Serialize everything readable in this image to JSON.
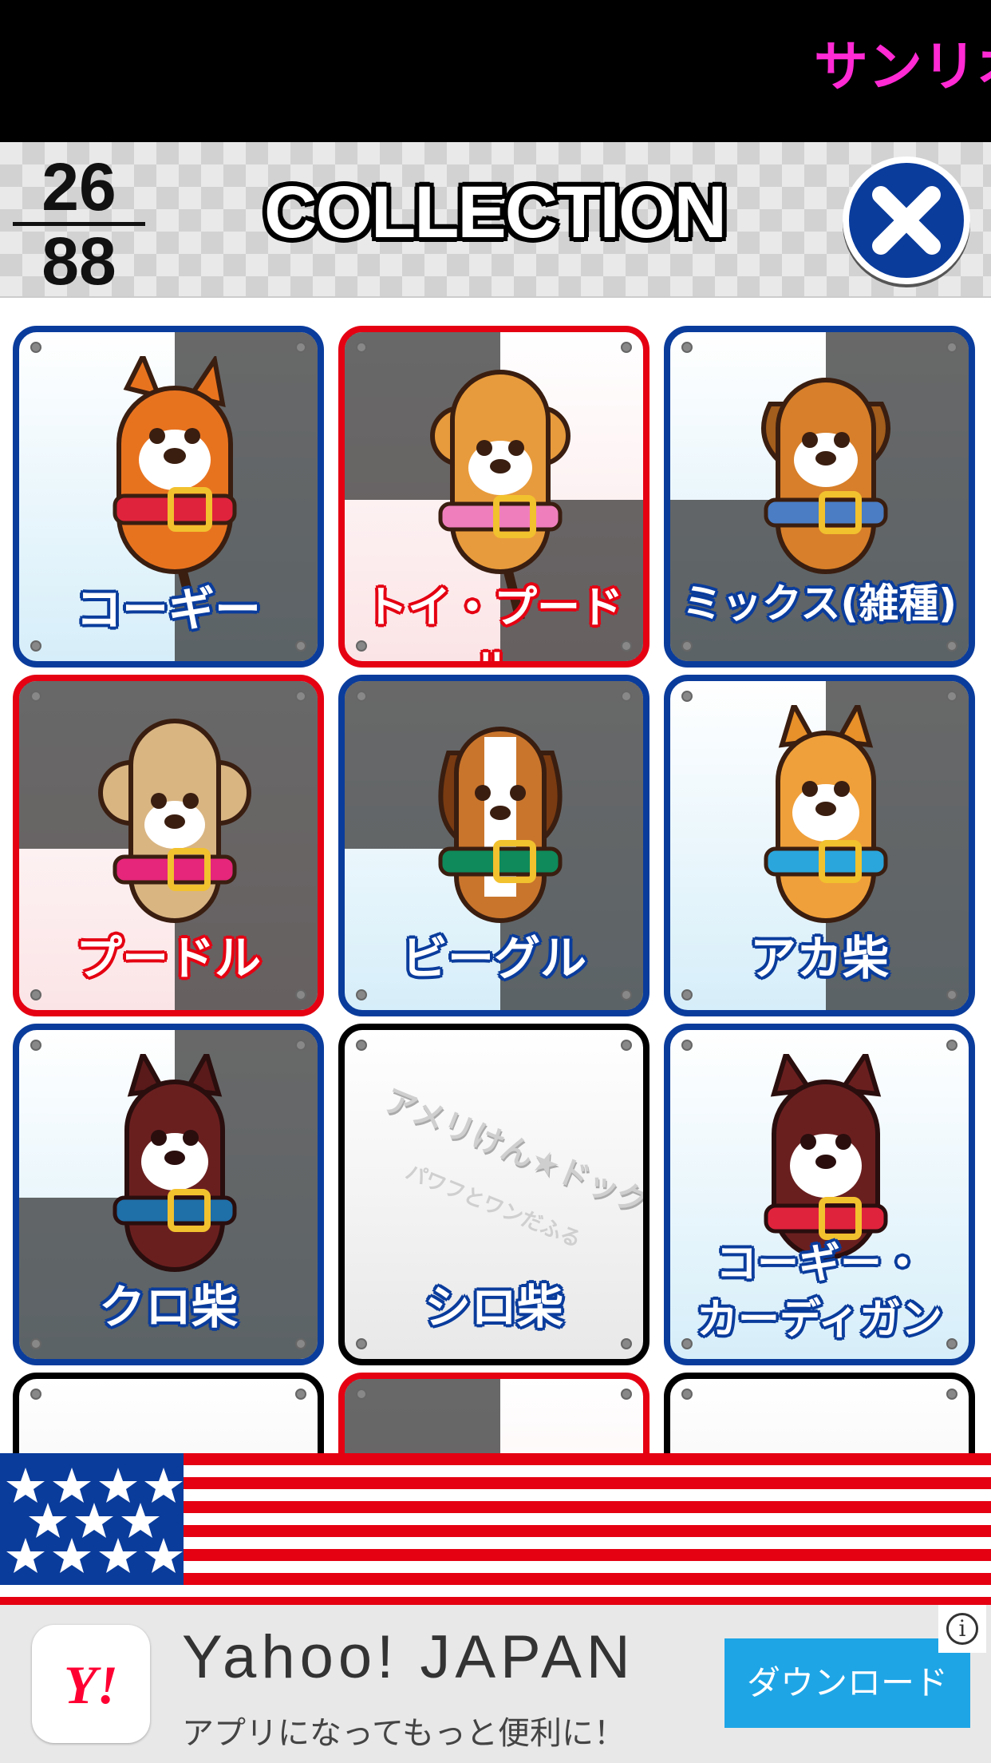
{
  "ticker": {
    "text": "サンリオ"
  },
  "header": {
    "count_collected": "26",
    "count_total": "88",
    "title": "COLLECTION",
    "close_icon": "close-icon"
  },
  "cards": [
    {
      "label": "コーギー",
      "frame": "blue"
    },
    {
      "label": "トイ・プードル",
      "frame": "red"
    },
    {
      "label": "ミックス(雑種)",
      "frame": "blue"
    },
    {
      "label": "プードル",
      "frame": "red"
    },
    {
      "label": "ビーグル",
      "frame": "blue"
    },
    {
      "label": "アカ柴",
      "frame": "blue"
    },
    {
      "label": "クロ柴",
      "frame": "blue"
    },
    {
      "label": "シロ柴",
      "frame": "black",
      "locked": true,
      "watermark": "アメリけん★ドッグ",
      "watermark_sub": "パワフとワンだふる"
    },
    {
      "label": "コーギー・",
      "label2": "カーディガン",
      "frame": "blue"
    }
  ],
  "ad": {
    "logo_text": "Y!",
    "title": "Yahoo! JAPAN",
    "subtitle": "アプリになってもっと便利に！",
    "button": "ダウンロード",
    "info": "i"
  },
  "colors": {
    "accent_blue": "#0a3c9c",
    "accent_red": "#e50012",
    "ticker": "#ff2ad4",
    "download": "#1ea5e6"
  }
}
